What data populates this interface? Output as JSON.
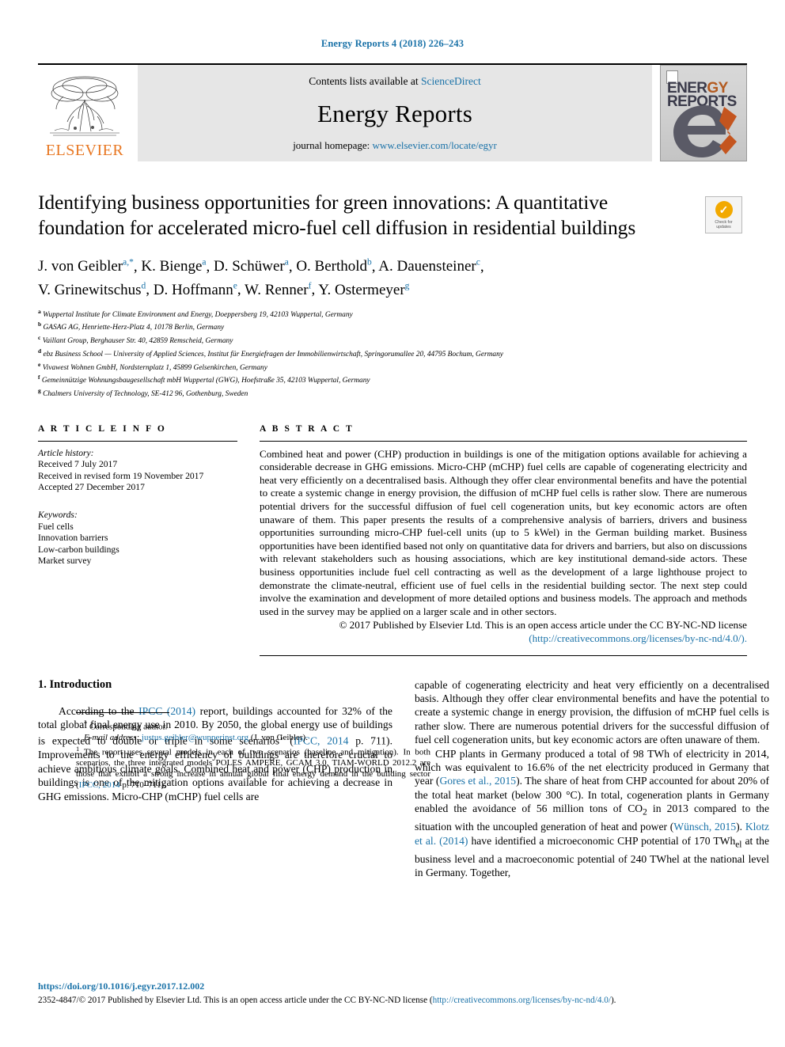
{
  "running_head": "Energy Reports 4 (2018) 226–243",
  "banner": {
    "publisher": "ELSEVIER",
    "contents_prefix": "Contents lists available at ",
    "contents_link": "ScienceDirect",
    "journal_name": "Energy Reports",
    "homepage_prefix": "journal homepage: ",
    "homepage_link": "www.elsevier.com/locate/egyr",
    "cover_title_1": "ENER",
    "cover_title_1_accent": "GY",
    "cover_title_2": "REPORTS"
  },
  "title": "Identifying business opportunities for green innovations: A quantitative foundation for accelerated micro-fuel cell diffusion in residential buildings",
  "crossmark": {
    "label_line1": "Check for",
    "label_line2": "updates",
    "check_glyph": "✓"
  },
  "authors_line_1": "J. von Geibler",
  "authors": [
    {
      "name": "J. von Geibler",
      "sup": "a,*"
    },
    {
      "name": "K. Bienge",
      "sup": "a"
    },
    {
      "name": "D. Schüwer",
      "sup": "a"
    },
    {
      "name": "O. Berthold",
      "sup": "b"
    },
    {
      "name": "A. Dauensteiner",
      "sup": "c"
    },
    {
      "name": "V. Grinewitschus",
      "sup": "d"
    },
    {
      "name": "D. Hoffmann",
      "sup": "e"
    },
    {
      "name": "W. Renner",
      "sup": "f"
    },
    {
      "name": "Y. Ostermeyer",
      "sup": "g"
    }
  ],
  "affiliations": [
    {
      "mark": "a",
      "text": "Wuppertal Institute for Climate Environment and Energy, Doeppersberg 19, 42103 Wuppertal, Germany"
    },
    {
      "mark": "b",
      "text": "GASAG AG, Henriette-Herz-Platz 4, 10178 Berlin, Germany"
    },
    {
      "mark": "c",
      "text": "Vaillant Group, Berghauser Str. 40, 42859 Remscheid, Germany"
    },
    {
      "mark": "d",
      "text": "ebz Business School — University of Applied Sciences, Institut für Energiefragen der Immobilienwirtschaft, Springorumallee 20, 44795 Bochum, Germany"
    },
    {
      "mark": "e",
      "text": "Vivawest Wohnen GmbH, Nordsternplatz 1, 45899 Gelsenkirchen, Germany"
    },
    {
      "mark": "f",
      "text": "Gemeinnützige Wohnungsbaugesellschaft mbH Wuppertal (GWG), Hoefstraße 35, 42103 Wuppertal, Germany"
    },
    {
      "mark": "g",
      "text": "Chalmers University of Technology, SE-412 96, Gothenburg, Sweden"
    }
  ],
  "article_info": {
    "heading": "A R T I C L E   I N F O",
    "history_label": "Article history:",
    "history": [
      "Received 7 July 2017",
      "Received in revised form 19 November 2017",
      "Accepted 27 December 2017"
    ],
    "keywords_label": "Keywords:",
    "keywords": [
      "Fuel cells",
      "Innovation barriers",
      "Low-carbon buildings",
      "Market survey"
    ]
  },
  "abstract": {
    "heading": "A B S T R A C T",
    "text": "Combined heat and power (CHP) production in buildings is one of the mitigation options available for achieving a considerable decrease in GHG emissions. Micro-CHP (mCHP) fuel cells are capable of cogenerating electricity and heat very efficiently on a decentralised basis. Although they offer clear environmental benefits and have the potential to create a systemic change in energy provision, the diffusion of mCHP fuel cells is rather slow. There are numerous potential drivers for the successful diffusion of fuel cell cogeneration units, but key economic actors are often unaware of them. This paper presents the results of a comprehensive analysis of barriers, drivers and business opportunities surrounding micro-CHP fuel-cell units (up to 5 kWel) in the German building market. Business opportunities have been identified based not only on quantitative data for drivers and barriers, but also on discussions with relevant stakeholders such as housing associations, which are key institutional demand-side actors. These business opportunities include fuel cell contracting as well as the development of a large lighthouse project to demonstrate the climate-neutral, efficient use of fuel cells in the residential building sector. The next step could involve the examination and development of more detailed options and business models. The approach and methods used in the survey may be applied on a larger scale and in other sectors.",
    "copyright": "© 2017 Published by Elsevier Ltd. This is an open access article under the CC BY-NC-ND license",
    "license_url": "(http://creativecommons.org/licenses/by-nc-nd/4.0/)."
  },
  "body": {
    "section_title": "1. Introduction",
    "left_paragraph_1_parts": [
      "According to the ",
      "IPCC (2014)",
      " report, buildings accounted for 32% of the total global final energy use in 2010. By 2050, the global energy use of buildings is expected to double or triple in some scenarios",
      "1",
      " (",
      "IPCC, 2014",
      " p. 711). Improvements to the energy efficiency of buildings are therefore crucial to achieve ambitious climate goals. Combined heat and power (CHP) production in buildings is one of the mitigation options available for achieving a decrease in GHG emissions. Micro-CHP (mCHP) fuel cells are"
    ],
    "right_paragraph_1": "capable of cogenerating electricity and heat very efficiently on a decentralised basis. Although they offer clear environmental benefits and have the potential to create a systemic change in energy provision, the diffusion of mCHP fuel cells is rather slow. There are numerous potential drivers for the successful diffusion of fuel cell cogeneration units, but key economic actors are often unaware of them.",
    "right_paragraph_2_parts": [
      "CHP plants in Germany produced a total of 98 TWh of electricity in 2014, which was equivalent to 16.6% of the net electricity produced in Germany that year (",
      "Gores et al., 2015",
      "). The share of heat from CHP accounted for about 20% of the total heat market (below 300 °C). In total, cogeneration plants in Germany enabled the avoidance of 56 million tons of CO",
      "2",
      " in 2013 compared to the situation with the uncoupled generation of heat and power (",
      "Wünsch, 2015",
      "). ",
      "Klotz et al. (2014)",
      " have identified a microeconomic CHP potential of 170 TWh",
      "el",
      " at the business level and a macroeconomic potential of 240 TWhel at the national level in Germany. Together,"
    ]
  },
  "footnotes": {
    "corresponding_mark": "*",
    "corresponding_text": "Corresponding author.",
    "email_label": "E-mail address:",
    "email": "justus.geibler@wupperinst.org",
    "email_suffix": "(J. von Geibler).",
    "note_mark": "1",
    "note_parts": [
      "The report uses several models in each of two scenarios (baseline and mitigation). In both scenarios, the three integrated models POLES AMPERE, GCAM 3.0, TIAM-WORLD 2012.2 are those that exhibit a strong increase in annual global final energy demand in the building sector (",
      "IPCC, 2014",
      " p. 710–711)."
    ]
  },
  "footer": {
    "doi": "https://doi.org/10.1016/j.egyr.2017.12.002",
    "issn_text": "2352-4847/© 2017 Published by Elsevier Ltd. This is an open access article under the CC BY-NC-ND license (",
    "issn_link": "http://creativecommons.org/licenses/by-nc-nd/4.0/",
    "issn_tail": ")."
  }
}
